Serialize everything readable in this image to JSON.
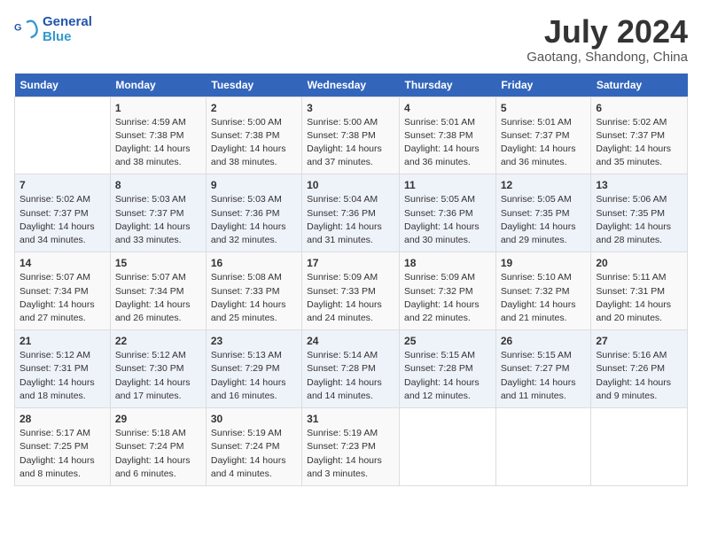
{
  "header": {
    "logo_line1": "General",
    "logo_line2": "Blue",
    "month": "July 2024",
    "location": "Gaotang, Shandong, China"
  },
  "days_of_week": [
    "Sunday",
    "Monday",
    "Tuesday",
    "Wednesday",
    "Thursday",
    "Friday",
    "Saturday"
  ],
  "weeks": [
    [
      {
        "day": "",
        "info": ""
      },
      {
        "day": "1",
        "info": "Sunrise: 4:59 AM\nSunset: 7:38 PM\nDaylight: 14 hours\nand 38 minutes."
      },
      {
        "day": "2",
        "info": "Sunrise: 5:00 AM\nSunset: 7:38 PM\nDaylight: 14 hours\nand 38 minutes."
      },
      {
        "day": "3",
        "info": "Sunrise: 5:00 AM\nSunset: 7:38 PM\nDaylight: 14 hours\nand 37 minutes."
      },
      {
        "day": "4",
        "info": "Sunrise: 5:01 AM\nSunset: 7:38 PM\nDaylight: 14 hours\nand 36 minutes."
      },
      {
        "day": "5",
        "info": "Sunrise: 5:01 AM\nSunset: 7:37 PM\nDaylight: 14 hours\nand 36 minutes."
      },
      {
        "day": "6",
        "info": "Sunrise: 5:02 AM\nSunset: 7:37 PM\nDaylight: 14 hours\nand 35 minutes."
      }
    ],
    [
      {
        "day": "7",
        "info": "Sunrise: 5:02 AM\nSunset: 7:37 PM\nDaylight: 14 hours\nand 34 minutes."
      },
      {
        "day": "8",
        "info": "Sunrise: 5:03 AM\nSunset: 7:37 PM\nDaylight: 14 hours\nand 33 minutes."
      },
      {
        "day": "9",
        "info": "Sunrise: 5:03 AM\nSunset: 7:36 PM\nDaylight: 14 hours\nand 32 minutes."
      },
      {
        "day": "10",
        "info": "Sunrise: 5:04 AM\nSunset: 7:36 PM\nDaylight: 14 hours\nand 31 minutes."
      },
      {
        "day": "11",
        "info": "Sunrise: 5:05 AM\nSunset: 7:36 PM\nDaylight: 14 hours\nand 30 minutes."
      },
      {
        "day": "12",
        "info": "Sunrise: 5:05 AM\nSunset: 7:35 PM\nDaylight: 14 hours\nand 29 minutes."
      },
      {
        "day": "13",
        "info": "Sunrise: 5:06 AM\nSunset: 7:35 PM\nDaylight: 14 hours\nand 28 minutes."
      }
    ],
    [
      {
        "day": "14",
        "info": "Sunrise: 5:07 AM\nSunset: 7:34 PM\nDaylight: 14 hours\nand 27 minutes."
      },
      {
        "day": "15",
        "info": "Sunrise: 5:07 AM\nSunset: 7:34 PM\nDaylight: 14 hours\nand 26 minutes."
      },
      {
        "day": "16",
        "info": "Sunrise: 5:08 AM\nSunset: 7:33 PM\nDaylight: 14 hours\nand 25 minutes."
      },
      {
        "day": "17",
        "info": "Sunrise: 5:09 AM\nSunset: 7:33 PM\nDaylight: 14 hours\nand 24 minutes."
      },
      {
        "day": "18",
        "info": "Sunrise: 5:09 AM\nSunset: 7:32 PM\nDaylight: 14 hours\nand 22 minutes."
      },
      {
        "day": "19",
        "info": "Sunrise: 5:10 AM\nSunset: 7:32 PM\nDaylight: 14 hours\nand 21 minutes."
      },
      {
        "day": "20",
        "info": "Sunrise: 5:11 AM\nSunset: 7:31 PM\nDaylight: 14 hours\nand 20 minutes."
      }
    ],
    [
      {
        "day": "21",
        "info": "Sunrise: 5:12 AM\nSunset: 7:31 PM\nDaylight: 14 hours\nand 18 minutes."
      },
      {
        "day": "22",
        "info": "Sunrise: 5:12 AM\nSunset: 7:30 PM\nDaylight: 14 hours\nand 17 minutes."
      },
      {
        "day": "23",
        "info": "Sunrise: 5:13 AM\nSunset: 7:29 PM\nDaylight: 14 hours\nand 16 minutes."
      },
      {
        "day": "24",
        "info": "Sunrise: 5:14 AM\nSunset: 7:28 PM\nDaylight: 14 hours\nand 14 minutes."
      },
      {
        "day": "25",
        "info": "Sunrise: 5:15 AM\nSunset: 7:28 PM\nDaylight: 14 hours\nand 12 minutes."
      },
      {
        "day": "26",
        "info": "Sunrise: 5:15 AM\nSunset: 7:27 PM\nDaylight: 14 hours\nand 11 minutes."
      },
      {
        "day": "27",
        "info": "Sunrise: 5:16 AM\nSunset: 7:26 PM\nDaylight: 14 hours\nand 9 minutes."
      }
    ],
    [
      {
        "day": "28",
        "info": "Sunrise: 5:17 AM\nSunset: 7:25 PM\nDaylight: 14 hours\nand 8 minutes."
      },
      {
        "day": "29",
        "info": "Sunrise: 5:18 AM\nSunset: 7:24 PM\nDaylight: 14 hours\nand 6 minutes."
      },
      {
        "day": "30",
        "info": "Sunrise: 5:19 AM\nSunset: 7:24 PM\nDaylight: 14 hours\nand 4 minutes."
      },
      {
        "day": "31",
        "info": "Sunrise: 5:19 AM\nSunset: 7:23 PM\nDaylight: 14 hours\nand 3 minutes."
      },
      {
        "day": "",
        "info": ""
      },
      {
        "day": "",
        "info": ""
      },
      {
        "day": "",
        "info": ""
      }
    ]
  ]
}
